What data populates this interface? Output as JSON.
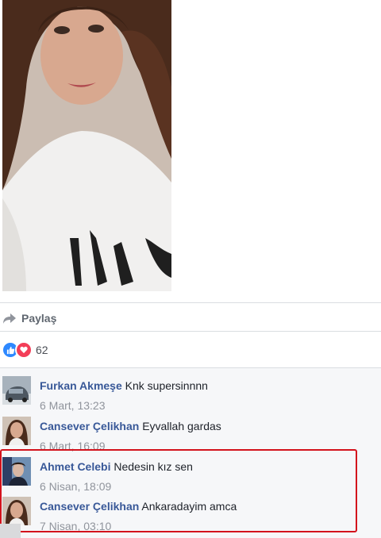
{
  "post": {
    "share_label": "Paylaş",
    "reaction_count": "62"
  },
  "comments": [
    {
      "author": "Furkan Akmeşe",
      "text": "Knk supersinnnn",
      "time": "6 Mart, 13:23"
    },
    {
      "author": "Cansever Çelikhan",
      "text": "Eyvallah gardas",
      "time": "6 Mart, 16:09"
    },
    {
      "author": "Ahmet Celebi",
      "text": "Nedesin kız sen",
      "time": "6 Nisan, 18:09"
    },
    {
      "author": "Cansever Çelikhan",
      "text": "Ankaradayim amca",
      "time": "7 Nisan, 03:10"
    }
  ],
  "colors": {
    "author_link": "#385898",
    "timestamp": "#90949c",
    "highlight_box": "#d3121c",
    "like": "#2d88ff",
    "love": "#f33e58"
  }
}
